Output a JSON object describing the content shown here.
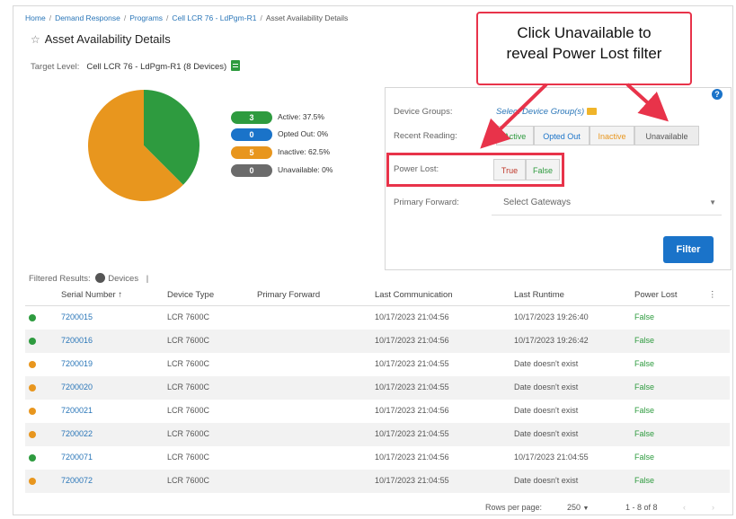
{
  "breadcrumb": {
    "items": [
      "Home",
      "Demand Response",
      "Programs",
      "Cell LCR 76 - LdPgm-R1"
    ],
    "current": "Asset Availability Details"
  },
  "page": {
    "title": "Asset Availability Details",
    "target_label": "Target Level:",
    "target_value": "Cell LCR 76 - LdPgm-R1 (8 Devices)"
  },
  "colors": {
    "active": "#2e9b3f",
    "opted_out": "#1a73c9",
    "inactive": "#e8961e",
    "unavailable": "#6b6b6b",
    "accent": "#1a73c9",
    "callout_border": "#e8334a"
  },
  "pie": {
    "slices": [
      {
        "name": "Active",
        "fraction": 0.375,
        "color": "#2e9b3f"
      },
      {
        "name": "Inactive",
        "fraction": 0.625,
        "color": "#e8961e"
      }
    ]
  },
  "legend": [
    {
      "count": "3",
      "label": "Active: 37.5%",
      "color": "#2e9b3f"
    },
    {
      "count": "0",
      "label": "Opted Out: 0%",
      "color": "#1a73c9"
    },
    {
      "count": "5",
      "label": "Inactive: 62.5%",
      "color": "#e8961e"
    },
    {
      "count": "0",
      "label": "Unavailable: 0%",
      "color": "#6b6b6b"
    }
  ],
  "filters": {
    "device_groups_label": "Device Groups:",
    "device_groups_link": "Select Device Group(s)",
    "recent_reading_label": "Recent Reading:",
    "recent_reading_options": [
      "Active",
      "Opted Out",
      "Inactive",
      "Unavailable"
    ],
    "power_lost_label": "Power Lost:",
    "power_lost_options": [
      "True",
      "False"
    ],
    "primary_forward_label": "Primary Forward:",
    "primary_forward_placeholder": "Select Gateways",
    "filter_button": "Filter",
    "help": "?"
  },
  "callout": {
    "line1": "Click Unavailable to",
    "line2": "reveal Power Lost filter"
  },
  "results": {
    "label": "Filtered Results:",
    "devices_label": "Devices",
    "separator": "|"
  },
  "table": {
    "columns": [
      "Serial Number ↑",
      "Device Type",
      "Primary Forward",
      "Last Communication",
      "Last Runtime",
      "Power Lost",
      "⋮"
    ],
    "rows": [
      {
        "status": "Active",
        "serial": "7200015",
        "type": "LCR 7600C",
        "forward": "",
        "last_comm": "10/17/2023 21:04:56",
        "last_runtime": "10/17/2023 19:26:40",
        "power_lost": "False"
      },
      {
        "status": "Active",
        "serial": "7200016",
        "type": "LCR 7600C",
        "forward": "",
        "last_comm": "10/17/2023 21:04:56",
        "last_runtime": "10/17/2023 19:26:42",
        "power_lost": "False"
      },
      {
        "status": "Inactive",
        "serial": "7200019",
        "type": "LCR 7600C",
        "forward": "",
        "last_comm": "10/17/2023 21:04:55",
        "last_runtime": "Date doesn't exist",
        "power_lost": "False"
      },
      {
        "status": "Inactive",
        "serial": "7200020",
        "type": "LCR 7600C",
        "forward": "",
        "last_comm": "10/17/2023 21:04:55",
        "last_runtime": "Date doesn't exist",
        "power_lost": "False"
      },
      {
        "status": "Inactive",
        "serial": "7200021",
        "type": "LCR 7600C",
        "forward": "",
        "last_comm": "10/17/2023 21:04:56",
        "last_runtime": "Date doesn't exist",
        "power_lost": "False"
      },
      {
        "status": "Inactive",
        "serial": "7200022",
        "type": "LCR 7600C",
        "forward": "",
        "last_comm": "10/17/2023 21:04:55",
        "last_runtime": "Date doesn't exist",
        "power_lost": "False"
      },
      {
        "status": "Active",
        "serial": "7200071",
        "type": "LCR 7600C",
        "forward": "",
        "last_comm": "10/17/2023 21:04:56",
        "last_runtime": "10/17/2023 21:04:55",
        "power_lost": "False"
      },
      {
        "status": "Inactive",
        "serial": "7200072",
        "type": "LCR 7600C",
        "forward": "",
        "last_comm": "10/17/2023 21:04:55",
        "last_runtime": "Date doesn't exist",
        "power_lost": "False"
      }
    ]
  },
  "pagination": {
    "rows_per_page_label": "Rows per page:",
    "rows_per_page_value": "250",
    "range": "1 - 8 of 8",
    "prev_icon": "chevron-left-icon",
    "next_icon": "chevron-right-icon"
  }
}
